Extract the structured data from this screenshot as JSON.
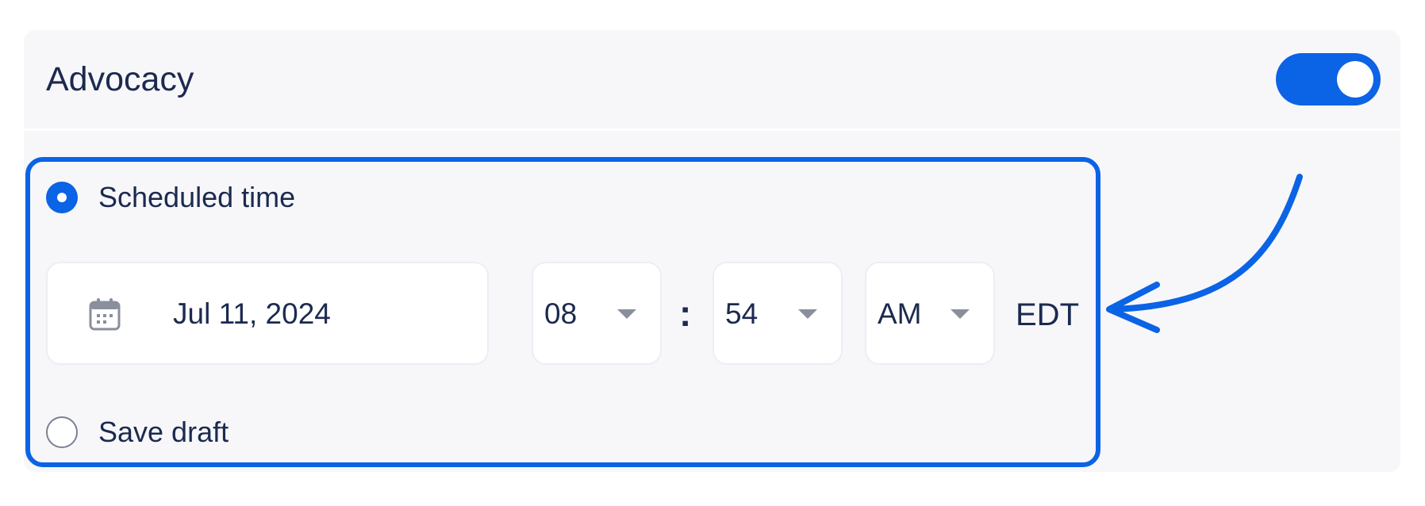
{
  "section": {
    "title": "Advocacy",
    "toggle_on": true
  },
  "schedule": {
    "options": [
      {
        "label": "Scheduled time",
        "selected": true
      },
      {
        "label": "Save draft",
        "selected": false
      }
    ],
    "date": "Jul 11, 2024",
    "hour": "08",
    "separator": ":",
    "minute": "54",
    "period": "AM",
    "timezone": "EDT"
  },
  "icons": {
    "date_icon": "calendar-icon",
    "dropdown_icon": "chevron-down-icon"
  },
  "colors": {
    "accent": "#0b63e5",
    "text": "#1c2a4f",
    "card_background": "#f7f7fa"
  }
}
